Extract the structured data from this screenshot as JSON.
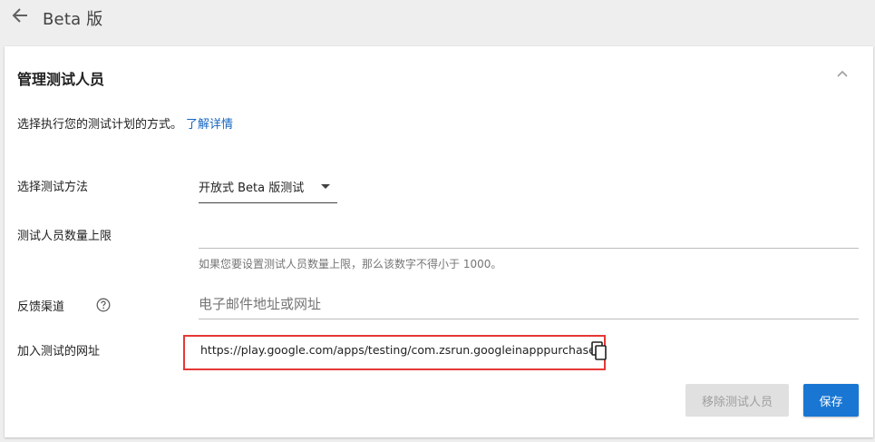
{
  "header": {
    "title": "Beta 版"
  },
  "card": {
    "title": "管理测试人员",
    "description": "选择执行您的测试计划的方式。",
    "learn_more": "了解详情"
  },
  "form": {
    "method_label": "选择测试方法",
    "method_value": "开放式 Beta 版测试",
    "limit_label": "测试人员数量上限",
    "limit_value": "",
    "limit_hint": "如果您要设置测试人员数量上限，那么该数字不得小于 1000。",
    "feedback_label": "反馈渠道",
    "feedback_placeholder": "电子邮件地址或网址",
    "url_label": "加入测试的网址",
    "url_value": "https://play.google.com/apps/testing/com.zsrun.googleinapppurchase"
  },
  "actions": {
    "remove_label": "移除测试人员",
    "save_label": "保存"
  },
  "colors": {
    "accent": "#1976d2",
    "link": "#1565c0",
    "highlight_border": "#e53935"
  }
}
